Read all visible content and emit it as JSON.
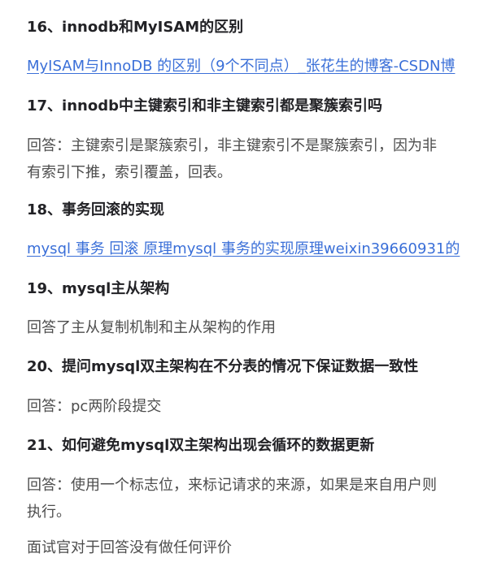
{
  "sections": {
    "s16": {
      "heading": "16、innodb和MyISAM的区别",
      "link": "MyISAM与InnoDB 的区别（9个不同点）_张花生的博客-CSDN博"
    },
    "s17": {
      "heading": "17、innodb中主键索引和非主键索引都是聚簇索引吗",
      "answer_line1": "回答：主键索引是聚簇索引，非主键索引不是聚簇索引，因为非",
      "answer_line2": "有索引下推，索引覆盖，回表。"
    },
    "s18": {
      "heading": "18、事务回滚的实现",
      "link": "mysql 事务 回滚 原理mysql 事务的实现原理weixin39660931的"
    },
    "s19": {
      "heading": "19、mysql主从架构",
      "answer": "回答了主从复制机制和主从架构的作用"
    },
    "s20": {
      "heading": "20、提问mysql双主架构在不分表的情况下保证数据一致性",
      "answer": "回答：pc两阶段提交"
    },
    "s21": {
      "heading": "21、如何避免mysql双主架构出现会循环的数据更新",
      "answer_line1": "回答：使用一个标志位，来标记请求的来源，如果是来自用户则",
      "answer_line2": "执行。"
    },
    "closing": "面试官对于回答没有做任何评价"
  }
}
